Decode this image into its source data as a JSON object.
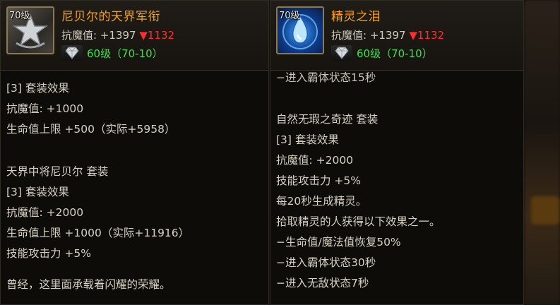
{
  "left": {
    "level_badge": "70级",
    "name": "尼贝尔的天界军衔",
    "stat": {
      "label": "抗魔值: +1397",
      "down_value": "▼1132"
    },
    "grade": "60级（70-10）",
    "lines": [
      "[3] 套装效果",
      "抗魔值: +1000",
      "生命值上限 +500（实际+5958）",
      "天界中将尼贝尔 套装",
      "[3] 套装效果",
      "抗魔值: +2000",
      "生命值上限 +1000（实际+11916）",
      "技能攻击力 +5%",
      "曾经，这里面承载着闪耀的荣耀。"
    ]
  },
  "right": {
    "level_badge": "70级",
    "name": "精灵之泪",
    "stat": {
      "label": "抗魔值: +1397",
      "down_value": "▼1132"
    },
    "grade": "60级（70-10）",
    "lines": [
      "−进入霸体状态15秒",
      "自然无瑕之奇迹 套装",
      "[3] 套装效果",
      "抗魔值: +2000",
      "技能攻击力 +5%",
      "每20秒生成精灵。",
      "拾取精灵的人获得以下效果之一。",
      "−生命值/魔法值恢复50%",
      "−进入霸体状态30秒",
      "−进入无敌状态7秒"
    ]
  },
  "icons": {
    "left_item": "star-emblem-icon",
    "right_item": "teardrop-crystal-icon",
    "grade_gem": "diamond-gem-icon"
  },
  "colors": {
    "item_name": "#f2a21d",
    "stat_down": "#ff2d2d",
    "grade": "#3ee04c",
    "body_text": "#d6d1c6"
  }
}
